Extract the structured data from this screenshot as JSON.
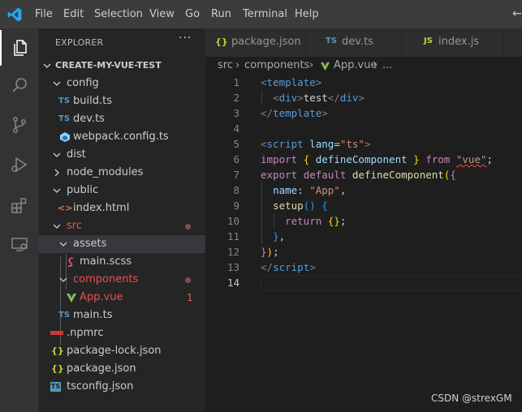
{
  "menubar": {
    "items": [
      "File",
      "Edit",
      "Selection",
      "View",
      "Go",
      "Run",
      "Terminal",
      "Help"
    ]
  },
  "activity_bar": {
    "icons": [
      "explorer-icon",
      "search-icon",
      "source-control-icon",
      "run-debug-icon",
      "extensions-icon",
      "remote-explorer-icon"
    ]
  },
  "sidebar": {
    "title": "EXPLORER",
    "more": "···",
    "root": "CREATE-MY-VUE-TEST",
    "tree": [
      {
        "label": "config",
        "type": "folder",
        "open": true
      },
      {
        "label": "build.ts",
        "type": "ts",
        "icon": "TS"
      },
      {
        "label": "dev.ts",
        "type": "ts",
        "icon": "TS"
      },
      {
        "label": "webpack.config.ts",
        "type": "webpack"
      },
      {
        "label": "dist",
        "type": "folder",
        "open": true
      },
      {
        "label": "node_modules",
        "type": "folder",
        "open": false
      },
      {
        "label": "public",
        "type": "folder",
        "open": true
      },
      {
        "label": "index.html",
        "type": "html",
        "icon": "<>"
      },
      {
        "label": "src",
        "type": "folder",
        "open": true,
        "modified": true
      },
      {
        "label": "assets",
        "type": "folder",
        "open": true
      },
      {
        "label": "main.scss",
        "type": "scss"
      },
      {
        "label": "components",
        "type": "folder",
        "open": true,
        "modified": true
      },
      {
        "label": "App.vue",
        "type": "vue",
        "badge": "1"
      },
      {
        "label": "main.ts",
        "type": "ts",
        "icon": "TS"
      },
      {
        "label": ".npmrc",
        "type": "npm"
      },
      {
        "label": "package-lock.json",
        "type": "json",
        "icon": "{}"
      },
      {
        "label": "package.json",
        "type": "json",
        "icon": "{}"
      },
      {
        "label": "tsconfig.json",
        "type": "tsconfig",
        "icon": "TS"
      }
    ]
  },
  "tabs": [
    {
      "label": "package.json",
      "icon": "{}"
    },
    {
      "label": "dev.ts",
      "icon": "TS"
    },
    {
      "label": "index.js",
      "icon": "JS"
    }
  ],
  "breadcrumb": [
    "src",
    "components",
    "App.vue",
    "..."
  ],
  "editor": {
    "current_line": 14,
    "line_numbers": [
      "1",
      "2",
      "3",
      "4",
      "5",
      "6",
      "7",
      "8",
      "9",
      "10",
      "11",
      "12",
      "13",
      "14"
    ],
    "lines": [
      [
        [
          "k-br",
          "<"
        ],
        [
          "k-tag",
          "template"
        ],
        [
          "k-br",
          ">"
        ]
      ],
      [
        [
          "k-txt",
          "  "
        ],
        [
          "k-br",
          "<"
        ],
        [
          "k-tag",
          "div"
        ],
        [
          "k-br",
          ">"
        ],
        [
          "k-txt",
          "test"
        ],
        [
          "k-br",
          "</"
        ],
        [
          "k-tag",
          "div"
        ],
        [
          "k-br",
          ">"
        ]
      ],
      [
        [
          "k-br",
          "</"
        ],
        [
          "k-tag",
          "template"
        ],
        [
          "k-br",
          ">"
        ]
      ],
      [],
      [
        [
          "k-br",
          "<"
        ],
        [
          "k-tag",
          "script"
        ],
        [
          "k-txt",
          " "
        ],
        [
          "k-attr",
          "lang"
        ],
        [
          "k-txt",
          "="
        ],
        [
          "k-str",
          "\"ts\""
        ],
        [
          "k-br",
          ">"
        ]
      ],
      [
        [
          "k-kw",
          "import"
        ],
        [
          "k-txt",
          " "
        ],
        [
          "k-b1",
          "{"
        ],
        [
          "k-txt",
          " "
        ],
        [
          "k-prop",
          "defineComponent"
        ],
        [
          "k-txt",
          " "
        ],
        [
          "k-b1",
          "}"
        ],
        [
          "k-txt",
          " "
        ],
        [
          "k-kw",
          "from"
        ],
        [
          "k-txt",
          " "
        ],
        [
          "k-str squig",
          "\"vue\""
        ],
        [
          "k-txt",
          ";"
        ]
      ],
      [
        [
          "k-kw",
          "export"
        ],
        [
          "k-txt",
          " "
        ],
        [
          "k-kw",
          "default"
        ],
        [
          "k-txt",
          " "
        ],
        [
          "k-fn",
          "defineComponent"
        ],
        [
          "k-b1",
          "("
        ],
        [
          "k-b2",
          "{"
        ]
      ],
      [
        [
          "k-txt",
          "  "
        ],
        [
          "k-prop",
          "name"
        ],
        [
          "k-txt",
          ": "
        ],
        [
          "k-str",
          "\"App\""
        ],
        [
          "k-txt",
          ","
        ]
      ],
      [
        [
          "k-txt",
          "  "
        ],
        [
          "k-fn",
          "setup"
        ],
        [
          "k-b3",
          "()"
        ],
        [
          "k-txt",
          " "
        ],
        [
          "k-b3",
          "{"
        ]
      ],
      [
        [
          "k-txt",
          "    "
        ],
        [
          "k-kw",
          "return"
        ],
        [
          "k-txt",
          " "
        ],
        [
          "k-b1",
          "{}"
        ],
        [
          "k-txt",
          ";"
        ]
      ],
      [
        [
          "k-txt",
          "  "
        ],
        [
          "k-b3",
          "}"
        ],
        [
          "k-txt",
          ","
        ]
      ],
      [
        [
          "k-b2",
          "}"
        ],
        [
          "k-b1",
          ")"
        ],
        [
          "k-txt",
          ";"
        ]
      ],
      [
        [
          "k-br",
          "</"
        ],
        [
          "k-tag",
          "script"
        ],
        [
          "k-br",
          ">"
        ]
      ],
      []
    ]
  },
  "watermark": "CSDN @strexGM",
  "colors": {
    "accent_ts": "#519aba",
    "accent_vue": "#8dc149",
    "accent_json": "#cbcb41",
    "accent_html": "#e37933",
    "git_modified": "#f14c4c"
  }
}
